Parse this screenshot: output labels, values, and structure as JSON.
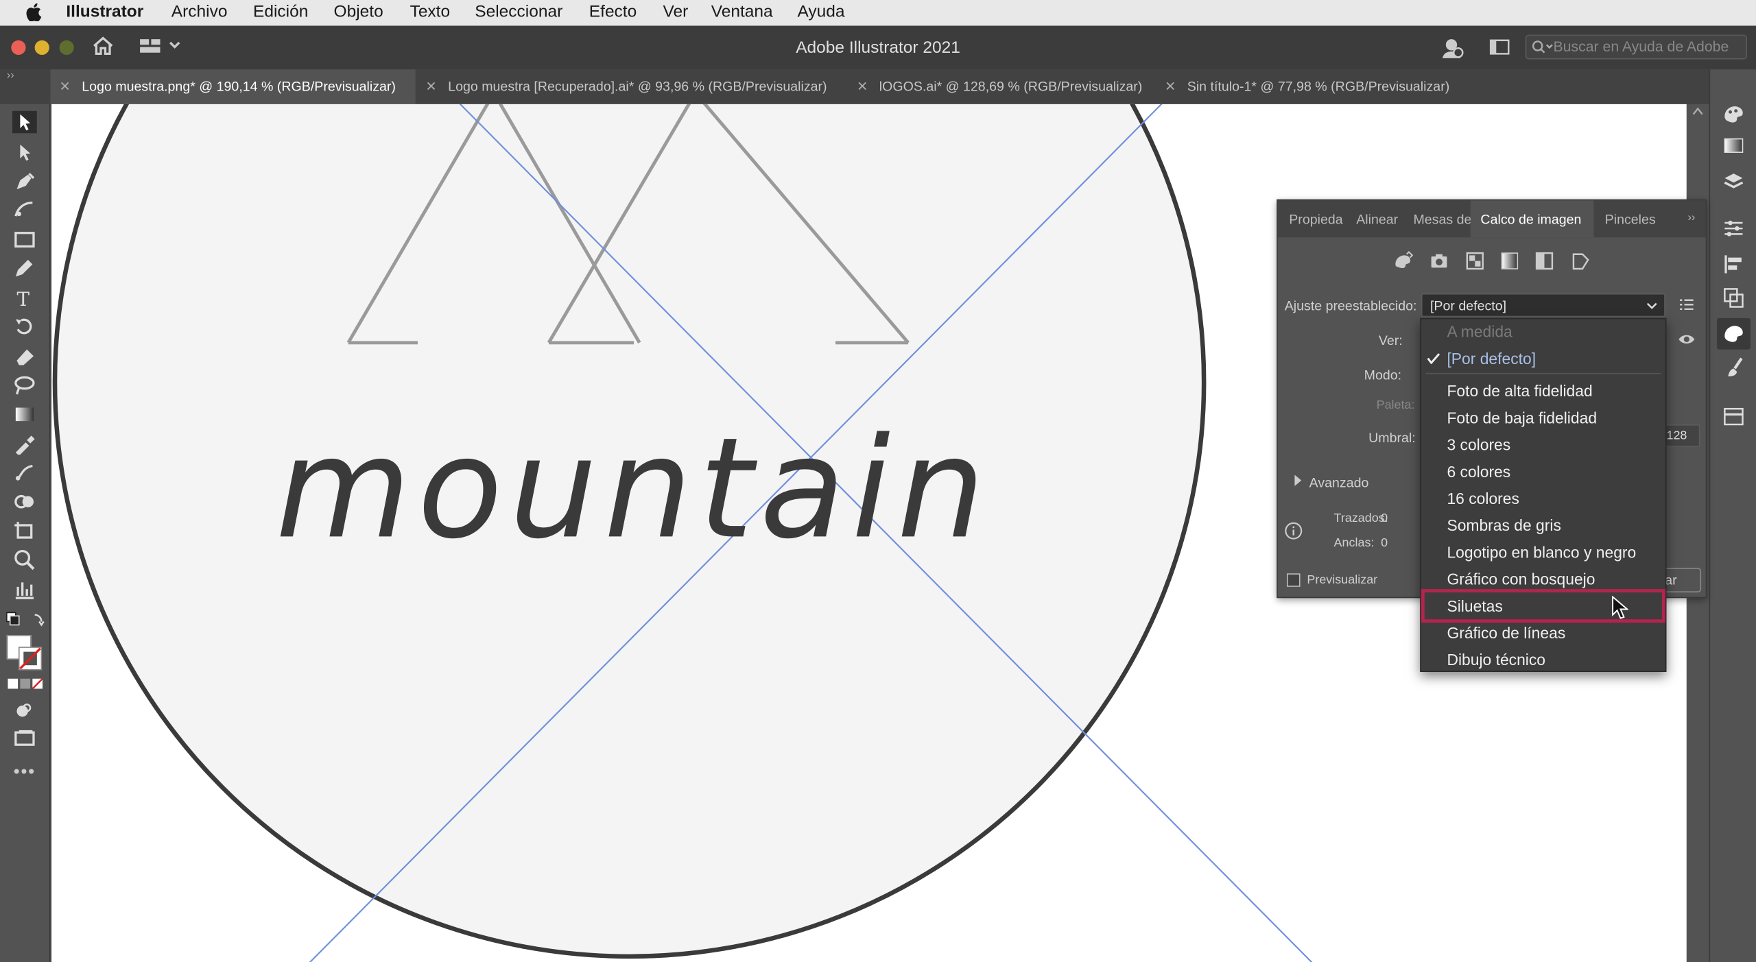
{
  "menubar": {
    "apple_icon": "apple-logo-icon",
    "app_name": "Illustrator",
    "items": [
      "Archivo",
      "Edición",
      "Objeto",
      "Texto",
      "Seleccionar",
      "Efecto",
      "Ver",
      "Ventana",
      "Ayuda"
    ]
  },
  "appbar": {
    "title": "Adobe Illustrator 2021",
    "search_placeholder": "Buscar en Ayuda de Adobe",
    "traffic_colors": [
      "#ec5f57",
      "#e0b02f",
      "#5f6d2f"
    ]
  },
  "document_tabs": [
    {
      "label": "Logo muestra.png* @ 190,14 % (RGB/Previsualizar)",
      "active": true
    },
    {
      "label": "Logo muestra [Recuperado].ai* @ 93,96 % (RGB/Previsualizar)",
      "active": false
    },
    {
      "label": "lOGOS.ai* @ 128,69 % (RGB/Previsualizar)",
      "active": false
    },
    {
      "label": "Sin título-1* @ 77,98 % (RGB/Previsualizar)",
      "active": false
    }
  ],
  "canvas": {
    "logo_text": "mountain",
    "guide_color": "#6f8fdc",
    "circle_fill": "#f4f4f4"
  },
  "panel": {
    "tabs": [
      "Propieda",
      "Alinear",
      "Mesas de",
      "Calco de imagen",
      "Pinceles"
    ],
    "active_tab": "Calco de imagen",
    "preset_label": "Ajuste preestablecido:",
    "preset_value": "[Por defecto]",
    "ver_label": "Ver:",
    "modo_label": "Modo:",
    "paleta_label": "Paleta:",
    "umbral_label": "Umbral:",
    "umbral_value": "128",
    "avanzado_label": "Avanzado",
    "trazados_label": "Trazados:",
    "trazados_value": "0",
    "anclas_label": "Anclas:",
    "anclas_value": "0",
    "preview_label": "Previsualizar",
    "trace_button": "Calcar"
  },
  "dropdown": {
    "items": [
      {
        "label": "A medida",
        "state": "disabled"
      },
      {
        "label": "[Por defecto]",
        "state": "checked"
      },
      {
        "label": "Foto de alta fidelidad",
        "state": "normal"
      },
      {
        "label": "Foto de baja fidelidad",
        "state": "normal"
      },
      {
        "label": "3 colores",
        "state": "normal"
      },
      {
        "label": "6 colores",
        "state": "normal"
      },
      {
        "label": "16 colores",
        "state": "normal"
      },
      {
        "label": "Sombras de gris",
        "state": "normal"
      },
      {
        "label": "Logotipo en blanco y negro",
        "state": "normal"
      },
      {
        "label": "Gráfico con bosquejo",
        "state": "normal"
      },
      {
        "label": "Siluetas",
        "state": "highlighted"
      },
      {
        "label": "Gráfico de líneas",
        "state": "normal"
      },
      {
        "label": "Dibujo técnico",
        "state": "normal"
      }
    ],
    "highlight_color": "#b5234f"
  }
}
